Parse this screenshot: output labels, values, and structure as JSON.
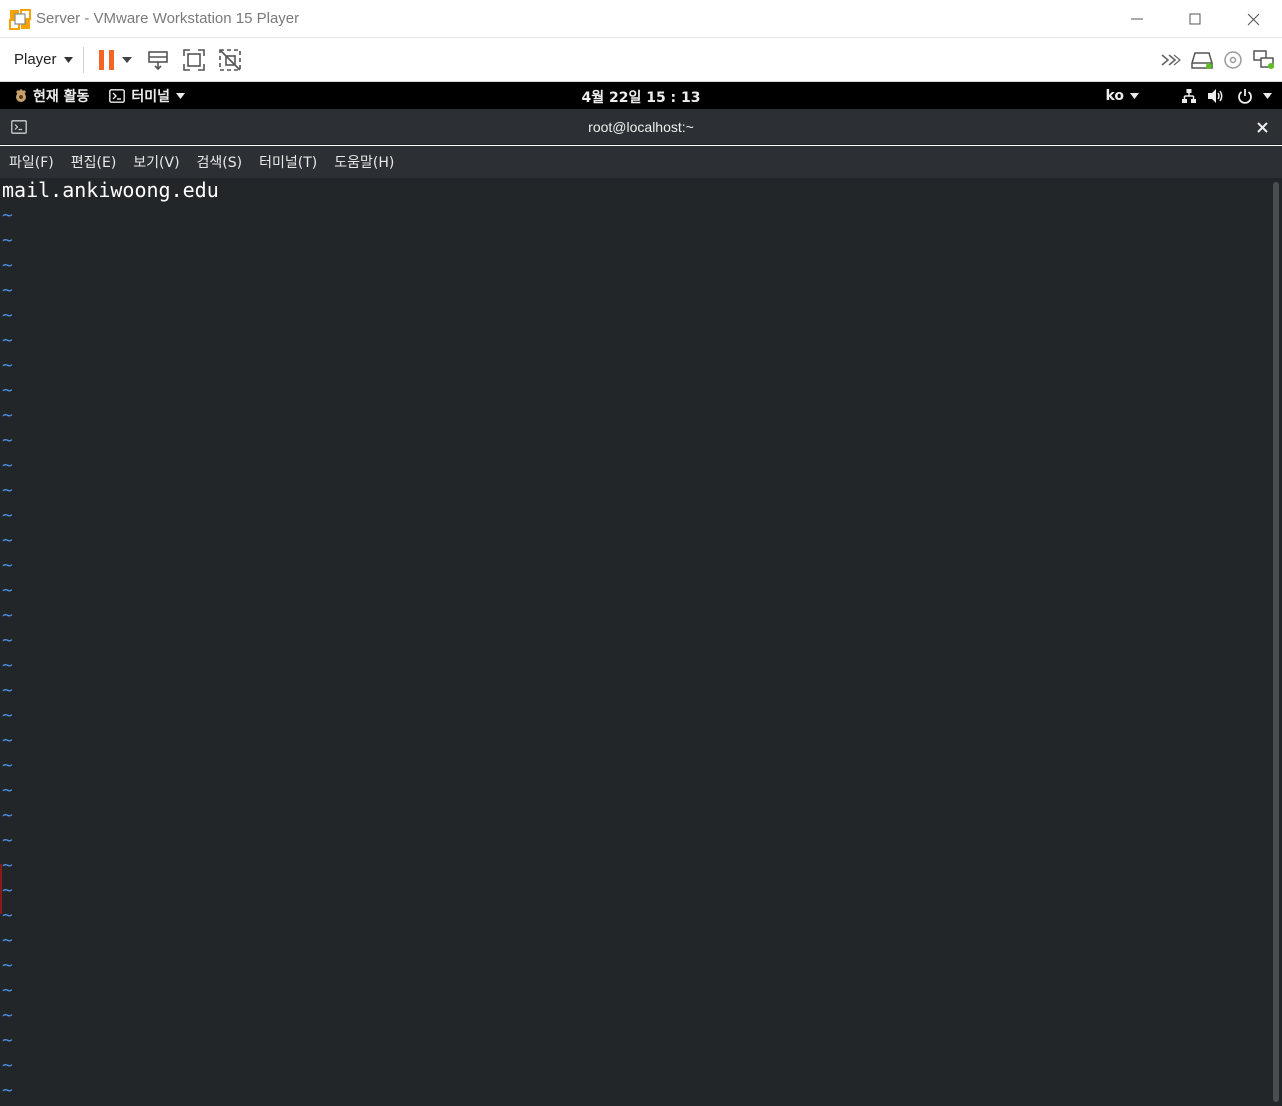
{
  "window": {
    "title": "Server - VMware Workstation 15 Player",
    "accent": "#f4a300"
  },
  "toolbar": {
    "player_label": "Player",
    "pause_color": "#f26522"
  },
  "gnome": {
    "activities_label": "현재 활동",
    "app_menu_label": "터미널",
    "clock": "4월 22일 15 : 13",
    "lang": "ko"
  },
  "terminal": {
    "title": "root@localhost:~",
    "menu": [
      "파일(F)",
      "편집(E)",
      "보기(V)",
      "검색(S)",
      "터미널(T)",
      "도움말(H)"
    ],
    "content_lines": [
      "mail.ankiwoong.edu"
    ],
    "empty_marker": "~",
    "empty_line_count": 36,
    "tilde_color": "#4a8fe0"
  }
}
